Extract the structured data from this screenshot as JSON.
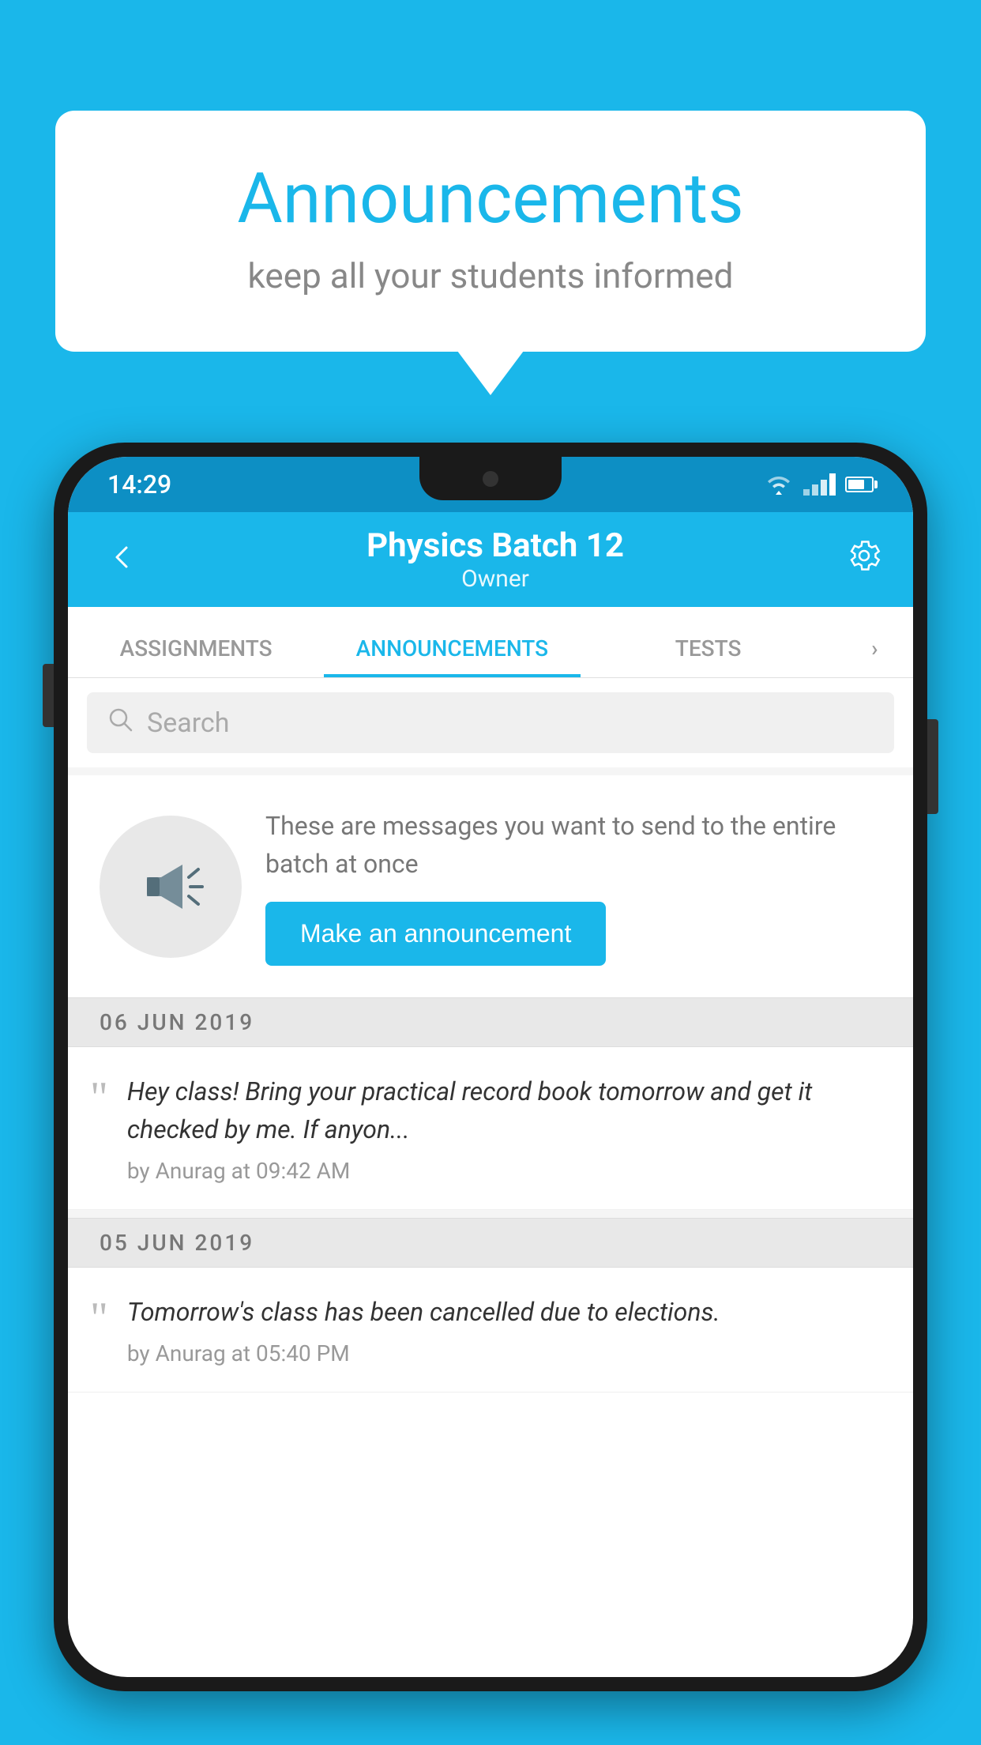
{
  "bubble": {
    "title": "Announcements",
    "subtitle": "keep all your students informed"
  },
  "statusBar": {
    "time": "14:29"
  },
  "appBar": {
    "title": "Physics Batch 12",
    "subtitle": "Owner"
  },
  "tabs": [
    {
      "label": "ASSIGNMENTS",
      "active": false
    },
    {
      "label": "ANNOUNCEMENTS",
      "active": true
    },
    {
      "label": "TESTS",
      "active": false
    },
    {
      "label": "",
      "active": false
    }
  ],
  "search": {
    "placeholder": "Search"
  },
  "announcementCard": {
    "description": "These are messages you want to send to the entire batch at once",
    "buttonLabel": "Make an announcement"
  },
  "dates": [
    {
      "label": "06  JUN  2019",
      "announcements": [
        {
          "message": "Hey class! Bring your practical record book tomorrow and get it checked by me. If anyon...",
          "meta": "by Anurag at 09:42 AM"
        }
      ]
    },
    {
      "label": "05  JUN  2019",
      "announcements": [
        {
          "message": "Tomorrow's class has been cancelled due to elections.",
          "meta": "by Anurag at 05:40 PM"
        }
      ]
    }
  ],
  "colors": {
    "primary": "#1ab7ea",
    "background": "#1ab7ea"
  }
}
